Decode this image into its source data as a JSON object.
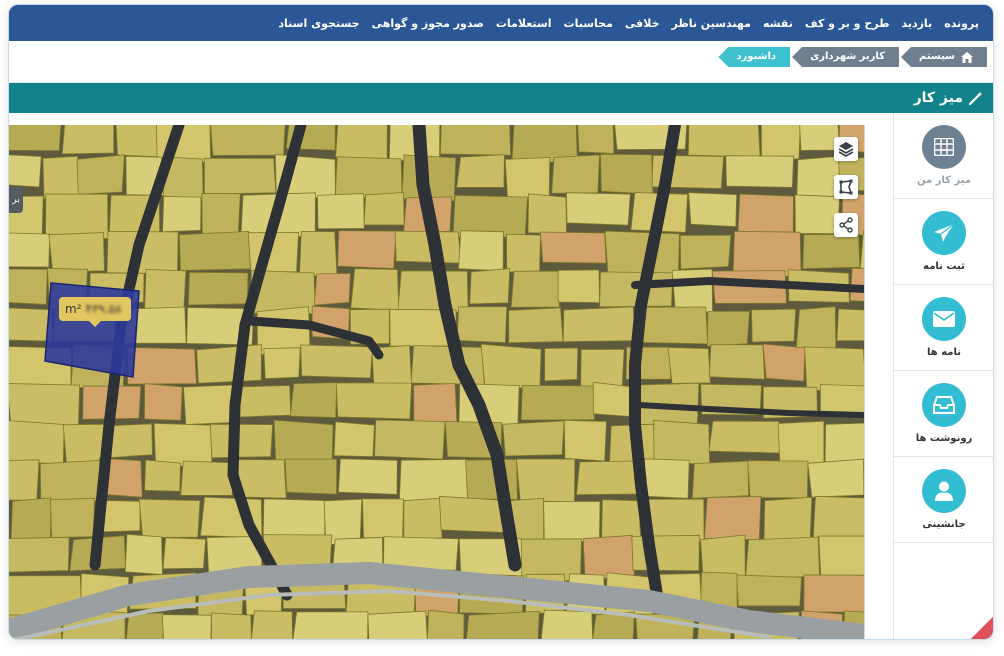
{
  "nav": {
    "items": [
      {
        "label": "پرونده",
        "name": "nav-parvandeh"
      },
      {
        "label": "بازدید",
        "name": "nav-bazdid"
      },
      {
        "label": "طرح و بر و کف",
        "name": "nav-tarh"
      },
      {
        "label": "نقشه",
        "name": "nav-naghshe"
      },
      {
        "label": "مهندسین ناظر",
        "name": "nav-mohandesin"
      },
      {
        "label": "خلافی",
        "name": "nav-khalafi"
      },
      {
        "label": "محاسبات",
        "name": "nav-mohasebat"
      },
      {
        "label": "استعلامات",
        "name": "nav-esteelamat"
      },
      {
        "label": "صدور مجوز و گواهی",
        "name": "nav-sodoor"
      },
      {
        "label": "جستجوی اسناد",
        "name": "nav-jostoju"
      }
    ]
  },
  "breadcrumb": {
    "items": [
      {
        "label": "سیستم",
        "color": "grey"
      },
      {
        "label": "کاربر شهرداری",
        "color": "grey"
      },
      {
        "label": "داشبورد",
        "color": "cyan"
      }
    ]
  },
  "desk": {
    "title": "میز کار",
    "icon": "magic-wand-icon"
  },
  "sidebar": {
    "items": [
      {
        "label": "میز کار من",
        "icon": "grid-icon",
        "color": "#6d8193",
        "label_color": "#9aa4ad"
      },
      {
        "label": "ثبت نامه",
        "icon": "send-icon",
        "color": "#32bdd3",
        "label_color": "#333333"
      },
      {
        "label": "نامه ها",
        "icon": "envelope-icon",
        "color": "#32bdd3",
        "label_color": "#333333"
      },
      {
        "label": "رونوشت ها",
        "icon": "inbox-icon",
        "color": "#32bdd3",
        "label_color": "#333333"
      },
      {
        "label": "جانشینی",
        "icon": "user-icon",
        "color": "#32bdd3",
        "label_color": "#333333"
      }
    ]
  },
  "map": {
    "area_unit": "m²",
    "area_value": "۴۳۹.۵۸",
    "side_tab": "بر",
    "tools": [
      "layers-icon",
      "polygon-draw-icon",
      "share-icon"
    ]
  },
  "colors": {
    "nav": "#2b5797",
    "desk_bar": "#12838a",
    "accent": "#32bdd3",
    "parcel": "#d8cc6a",
    "selected_parcel": "#2e3a9a"
  }
}
